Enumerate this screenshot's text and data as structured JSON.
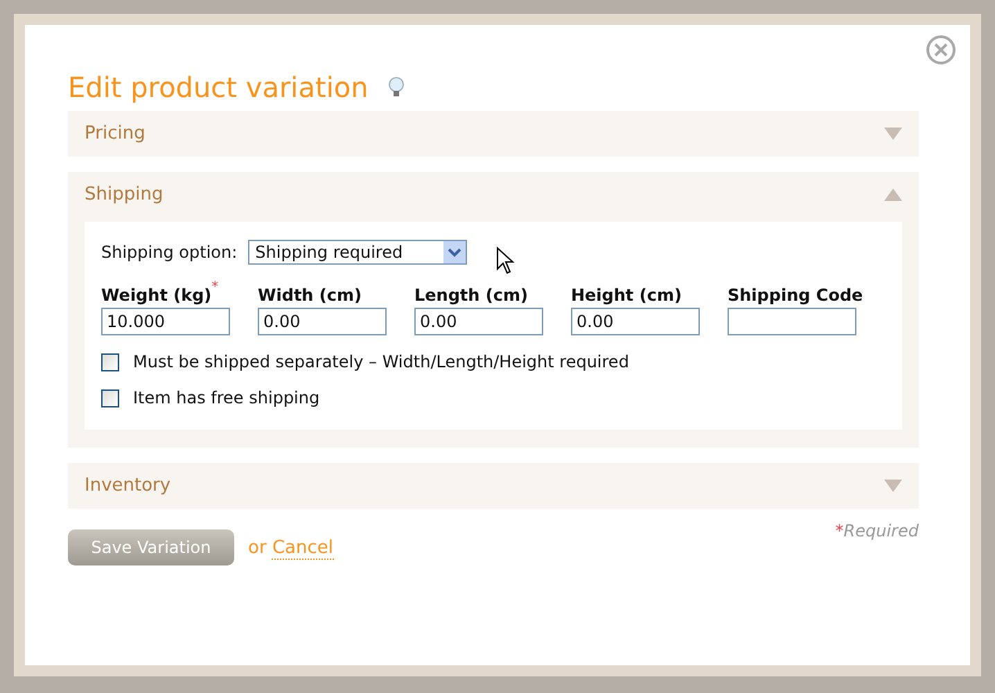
{
  "dialog": {
    "title": "Edit product variation",
    "sections": [
      {
        "title": "Pricing",
        "expanded": false
      },
      {
        "title": "Shipping",
        "expanded": true,
        "shipping_option": {
          "label": "Shipping option:",
          "value": "Shipping required"
        },
        "fields": [
          {
            "label": "Weight (kg)",
            "mark": "*",
            "value": "10.000"
          },
          {
            "label": "Width (cm)",
            "value": "0.00"
          },
          {
            "label": "Length (cm)",
            "value": "0.00"
          },
          {
            "label": "Height (cm)",
            "value": "0.00"
          },
          {
            "label": "Shipping Code"
          }
        ],
        "checkboxes": [
          {
            "label": "Must be shipped separately – Width/Length/Height required",
            "checked": false
          },
          {
            "label": "Item has free shipping",
            "checked": false
          }
        ]
      },
      {
        "title": "Inventory",
        "expanded": false
      }
    ],
    "save_button": "Save Variation",
    "cancel_prefix": "or",
    "cancel_link": "Cancel",
    "required_mark": "*",
    "required_note": "Required"
  }
}
